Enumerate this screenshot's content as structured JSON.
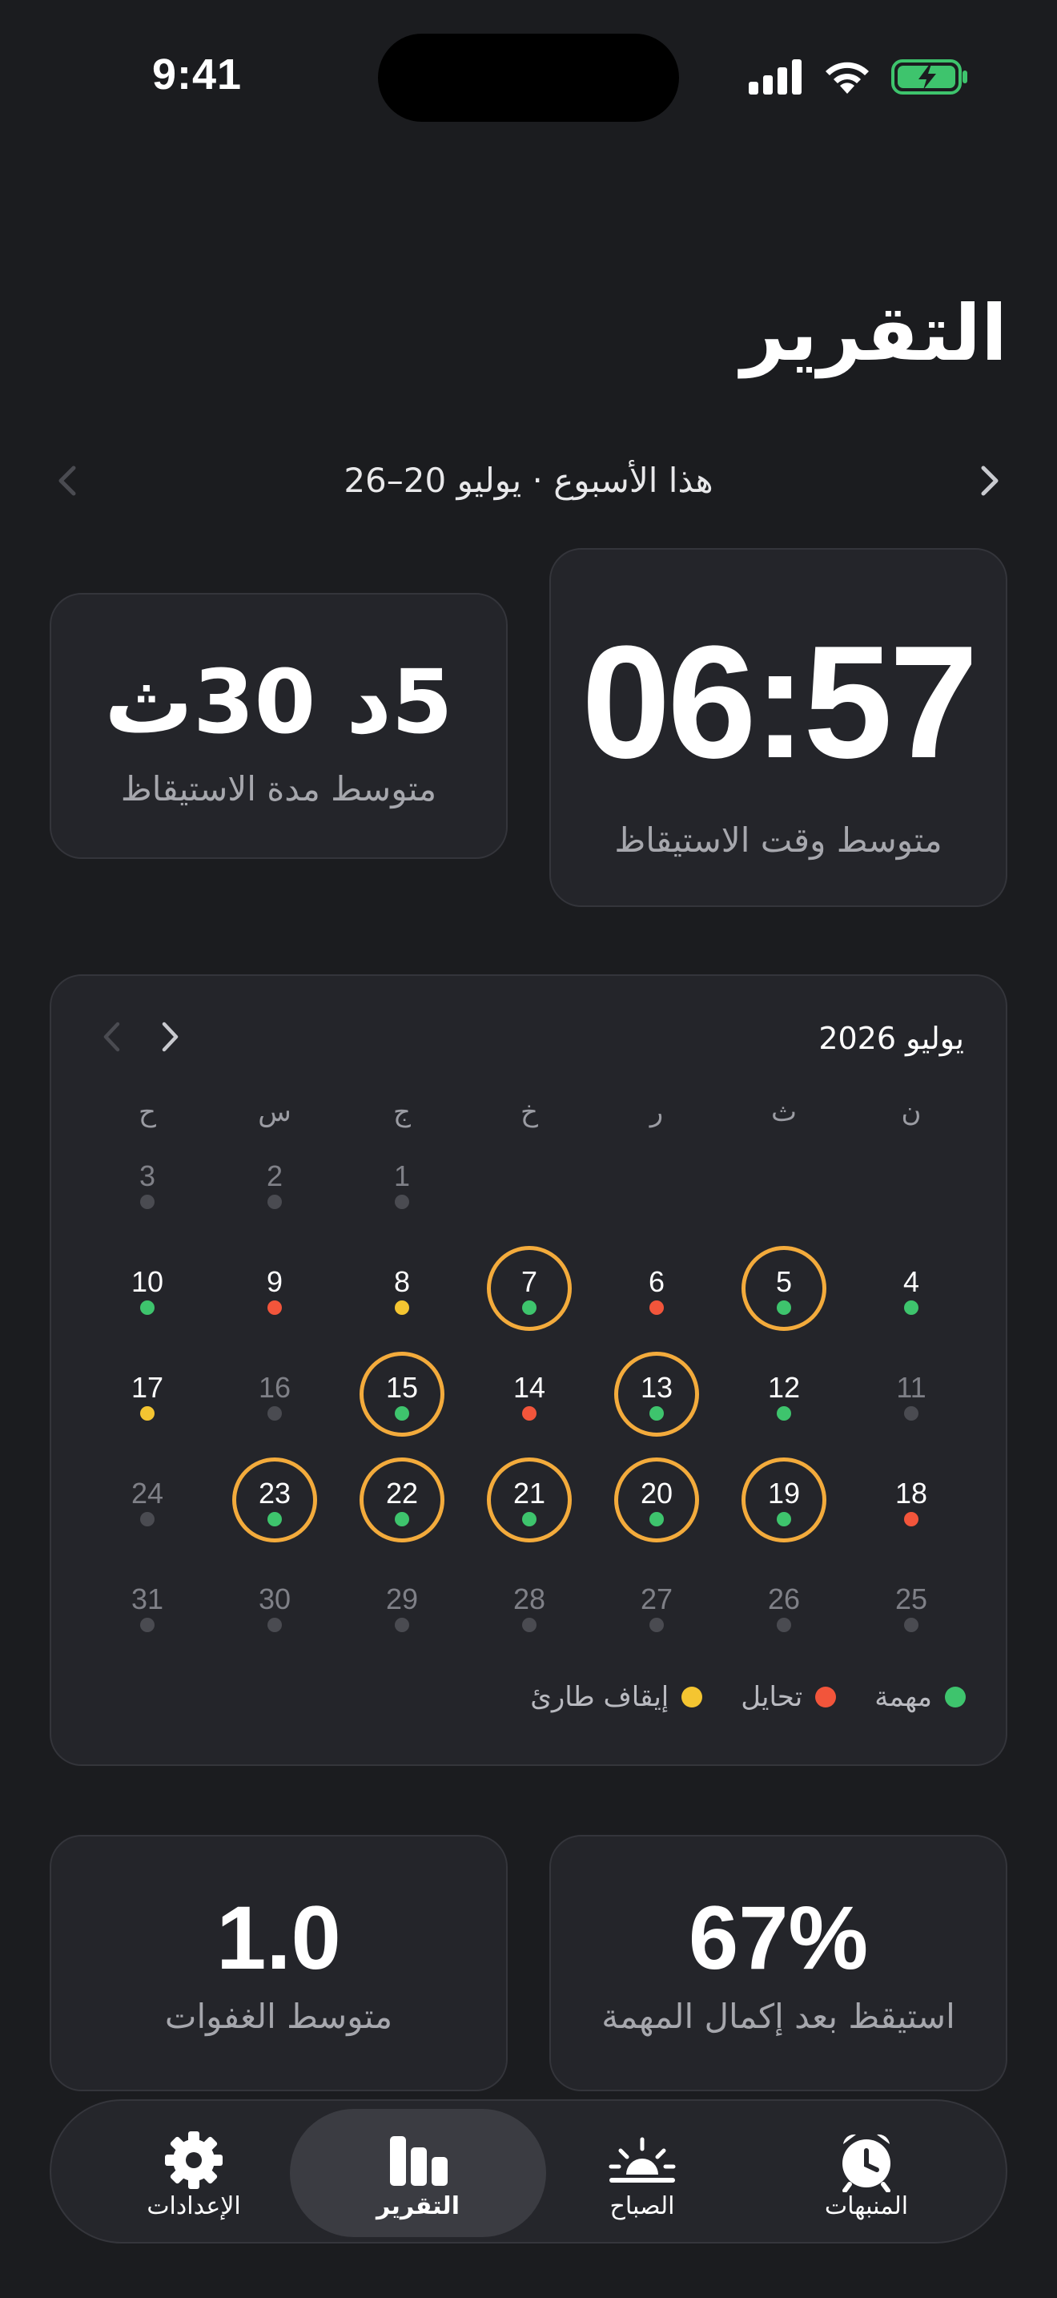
{
  "status_bar": {
    "time": "9:41"
  },
  "page_title": "التقرير",
  "week_nav": {
    "label": "هذا الأسبوع · يوليو 20–26"
  },
  "stats_top": {
    "avg_wake_time": {
      "value": "06:57",
      "label": "متوسط وقت الاستيقاظ"
    },
    "avg_wake_duration": {
      "value": "5د 30ث",
      "label": "متوسط مدة الاستيقاظ"
    }
  },
  "calendar": {
    "month_label": "يوليو 2026",
    "weekdays": [
      "ن",
      "ث",
      "ر",
      "خ",
      "ج",
      "س",
      "ح"
    ],
    "days": [
      {
        "n": "1",
        "dot": "gray",
        "ring": false,
        "dim": true
      },
      {
        "n": "2",
        "dot": "gray",
        "ring": false,
        "dim": true
      },
      {
        "n": "3",
        "dot": "gray",
        "ring": false,
        "dim": true
      },
      {
        "n": "4",
        "dot": "green",
        "ring": false,
        "dim": false
      },
      {
        "n": "5",
        "dot": "green",
        "ring": true,
        "dim": false
      },
      {
        "n": "6",
        "dot": "red",
        "ring": false,
        "dim": false
      },
      {
        "n": "7",
        "dot": "green",
        "ring": true,
        "dim": false
      },
      {
        "n": "8",
        "dot": "yellow",
        "ring": false,
        "dim": false
      },
      {
        "n": "9",
        "dot": "red",
        "ring": false,
        "dim": false
      },
      {
        "n": "10",
        "dot": "green",
        "ring": false,
        "dim": false
      },
      {
        "n": "11",
        "dot": "gray",
        "ring": false,
        "dim": true
      },
      {
        "n": "12",
        "dot": "green",
        "ring": false,
        "dim": false
      },
      {
        "n": "13",
        "dot": "green",
        "ring": true,
        "dim": false
      },
      {
        "n": "14",
        "dot": "red",
        "ring": false,
        "dim": false
      },
      {
        "n": "15",
        "dot": "green",
        "ring": true,
        "dim": false
      },
      {
        "n": "16",
        "dot": "gray",
        "ring": false,
        "dim": true
      },
      {
        "n": "17",
        "dot": "yellow",
        "ring": false,
        "dim": false
      },
      {
        "n": "18",
        "dot": "red",
        "ring": false,
        "dim": false
      },
      {
        "n": "19",
        "dot": "green",
        "ring": true,
        "dim": false
      },
      {
        "n": "20",
        "dot": "green",
        "ring": true,
        "dim": false
      },
      {
        "n": "21",
        "dot": "green",
        "ring": true,
        "dim": false
      },
      {
        "n": "22",
        "dot": "green",
        "ring": true,
        "dim": false
      },
      {
        "n": "23",
        "dot": "green",
        "ring": true,
        "dim": false
      },
      {
        "n": "24",
        "dot": "gray",
        "ring": false,
        "dim": true
      },
      {
        "n": "25",
        "dot": "gray",
        "ring": false,
        "dim": true
      },
      {
        "n": "26",
        "dot": "gray",
        "ring": false,
        "dim": true
      },
      {
        "n": "27",
        "dot": "gray",
        "ring": false,
        "dim": true
      },
      {
        "n": "28",
        "dot": "gray",
        "ring": false,
        "dim": true
      },
      {
        "n": "29",
        "dot": "gray",
        "ring": false,
        "dim": true
      },
      {
        "n": "30",
        "dot": "gray",
        "ring": false,
        "dim": true
      },
      {
        "n": "31",
        "dot": "gray",
        "ring": false,
        "dim": true
      }
    ],
    "legend": [
      {
        "label": "مهمة",
        "color": "#3ec46d"
      },
      {
        "label": "تحايل",
        "color": "#f2553b"
      },
      {
        "label": "إيقاف طارئ",
        "color": "#f4c531"
      }
    ]
  },
  "stats_bottom": {
    "after_task": {
      "value": "67%",
      "label": "استيقظ بعد إكمال المهمة"
    },
    "avg_snoozes": {
      "value": "1.0",
      "label": "متوسط الغفوات"
    }
  },
  "tab_bar": {
    "alarms": {
      "label": "المنبهات",
      "icon": "alarm-clock-icon"
    },
    "morning": {
      "label": "الصباح",
      "icon": "sunrise-icon"
    },
    "report": {
      "label": "التقرير",
      "icon": "bar-chart-icon"
    },
    "settings": {
      "label": "الإعدادات",
      "icon": "gear-icon"
    }
  },
  "colors": {
    "background": "#1b1c1f",
    "card": "#24252a",
    "ring": "#f3ab3c",
    "dot_green": "#3ec46d",
    "dot_red": "#f2553b",
    "dot_yellow": "#f4c531",
    "dot_gray": "#4a4b51"
  }
}
